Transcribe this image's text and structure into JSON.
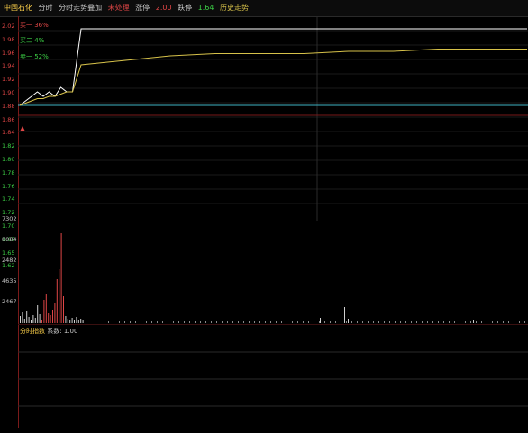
{
  "topbar": {
    "title": "中国石化",
    "mode": "分时",
    "desc": "分时走势叠加",
    "status": "未处理",
    "limit_up_label": "涨停",
    "limit_up_value": "2.00",
    "limit_down_label": "跌停",
    "limit_down_value": "1.64",
    "extra": "历史走势"
  },
  "y_labels": [
    "2.02",
    "1.98",
    "1.96",
    "1.94",
    "1.92",
    "1.90",
    "1.88",
    "1.86",
    "1.84",
    "1.82",
    "1.80",
    "1.78",
    "1.76",
    "1.74",
    "1.72",
    "1.70",
    "1.67",
    "1.65",
    "1.62"
  ],
  "vol_labels": [
    "7302",
    "8084",
    "2482",
    "4635",
    "2467"
  ],
  "tags": {
    "buy": "买一 36%",
    "mid": "买二 4%",
    "sell": "卖一 52%"
  },
  "indicator": {
    "title": "分时指数",
    "label": "系数:",
    "value": "1.00"
  },
  "colors": {
    "price_line": "#ffffff",
    "avg_line": "#d7c24a",
    "ref_line": "#3fb4c4",
    "vol_up": "#e04646",
    "vol_flat": "#cfcfcf"
  },
  "chart_data": {
    "type": "line",
    "series": [
      {
        "values": [
          1.83,
          1.84,
          1.85,
          1.86,
          1.85,
          1.86,
          1.85,
          1.87,
          1.86,
          1.86,
          2.0,
          2.0,
          2.0,
          2.0,
          2.0,
          2.0,
          2.0,
          2.0,
          2.0,
          2.0,
          2.0
        ]
      },
      {
        "values": [
          1.83,
          1.835,
          1.84,
          1.845,
          1.845,
          1.85,
          1.85,
          1.855,
          1.86,
          1.86,
          1.92,
          1.93,
          1.94,
          1.945,
          1.945,
          1.945,
          1.95,
          1.95,
          1.955,
          1.955,
          1.955
        ]
      }
    ],
    "ylim": [
      1.62,
      2.02
    ],
    "grid": true
  }
}
